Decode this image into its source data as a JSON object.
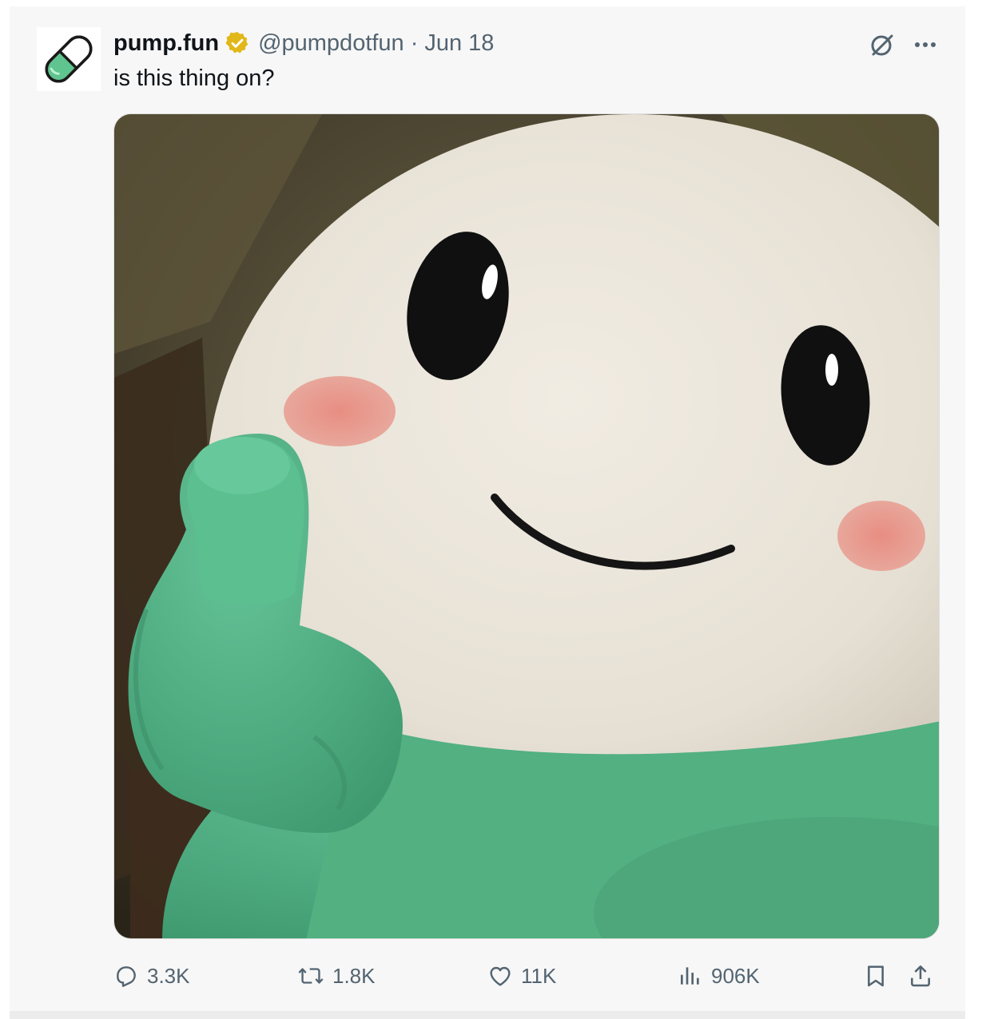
{
  "tweet": {
    "author": {
      "display_name": "pump.fun",
      "handle": "@pumpdotfun",
      "verified": true,
      "avatar_icon": "pill-icon"
    },
    "separator": "·",
    "date": "Jun 18",
    "text": "is this thing on?",
    "media": {
      "description": "plush-pill-mascot-pointing"
    },
    "actions": {
      "replies": "3.3K",
      "reposts": "1.8K",
      "likes": "11K",
      "views": "906K"
    },
    "icons": {
      "grok": "grok-icon",
      "more": "more-icon",
      "reply": "reply-icon",
      "repost": "repost-icon",
      "like": "heart-icon",
      "views": "analytics-icon",
      "bookmark": "bookmark-icon",
      "share": "share-icon"
    },
    "colors": {
      "secondary_text": "#536471",
      "primary_text": "#0f1419",
      "verified_gold": "#e2b719",
      "mascot_green": "#5bb88c"
    }
  }
}
